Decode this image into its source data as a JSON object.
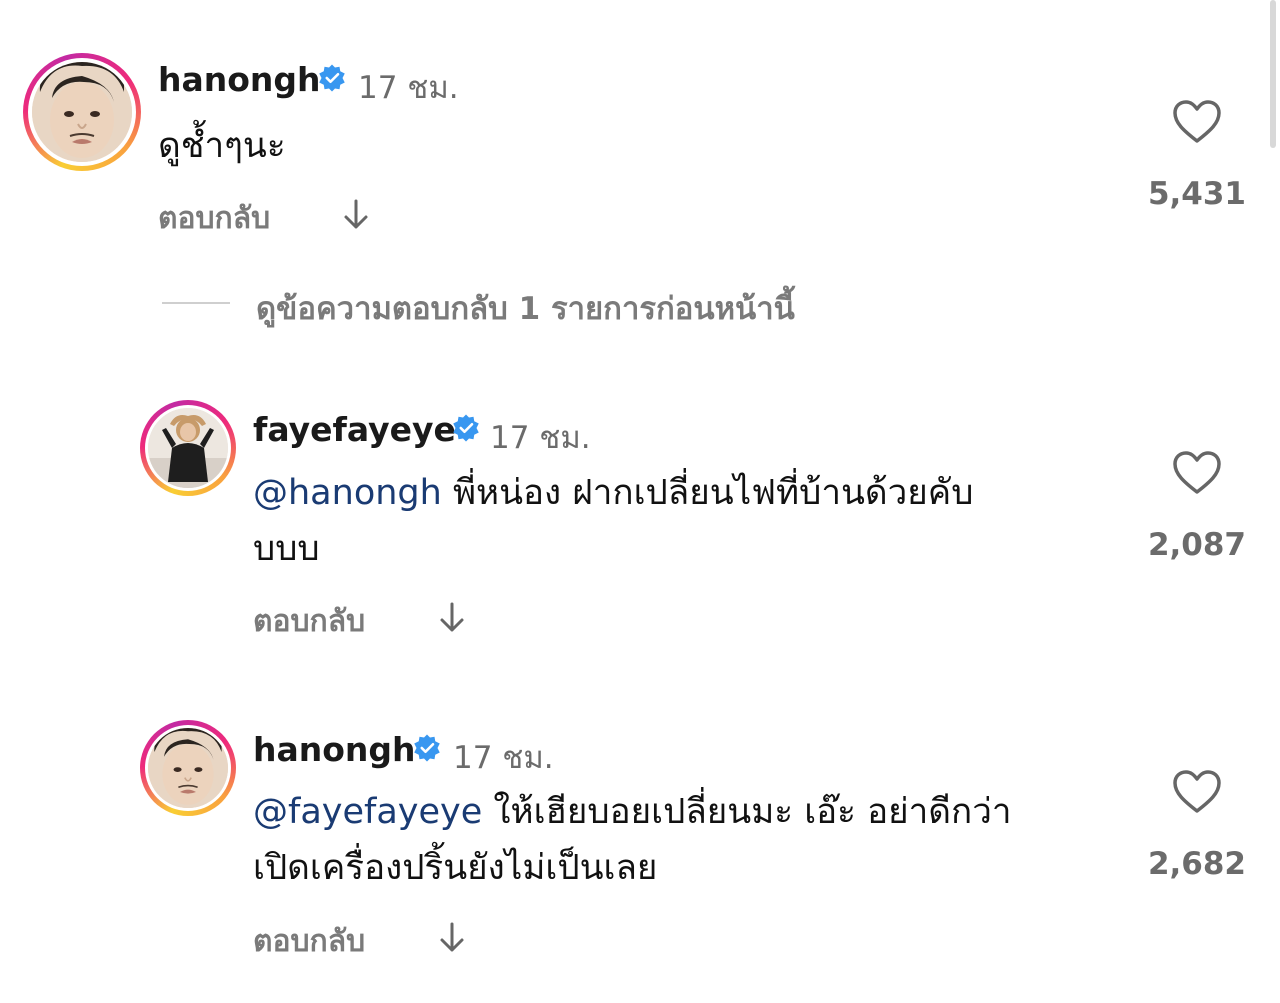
{
  "comments": [
    {
      "username": "hanongh",
      "time": "17 ชม.",
      "text": "ดูช้ำๆนะ",
      "mention": "",
      "reply_label": "ตอบกลับ",
      "likes": "5,431"
    },
    {
      "username": "fayefayeye",
      "time": "17 ชม.",
      "mention": "@hanongh",
      "text": " พี่หน่อง ฝากเปลี่ยนไฟที่บ้านด้วยคับ",
      "text_line2": "บบบ",
      "reply_label": "ตอบกลับ",
      "likes": "2,087"
    },
    {
      "username": "hanongh",
      "time": "17 ชม.",
      "mention": "@fayefayeye",
      "text": " ให้เฮียบอยเปลี่ยนมะ  เอ๊ะ อย่าดีกว่า",
      "text_line2": "เปิดเครื่องปริ้นยังไม่เป็นเลย",
      "reply_label": "ตอบกลับ",
      "likes": "2,682"
    }
  ],
  "view_previous_replies": "ดูข้อความตอบกลับ 1 รายการก่อนหน้านี้",
  "icons": {
    "verified": "verified-badge-icon",
    "heart": "heart-outline-icon",
    "arrow": "arrow-down-icon"
  },
  "colors": {
    "verified_blue": "#3897f0",
    "mention": "#1a3b73",
    "muted": "#6b6b6b"
  }
}
